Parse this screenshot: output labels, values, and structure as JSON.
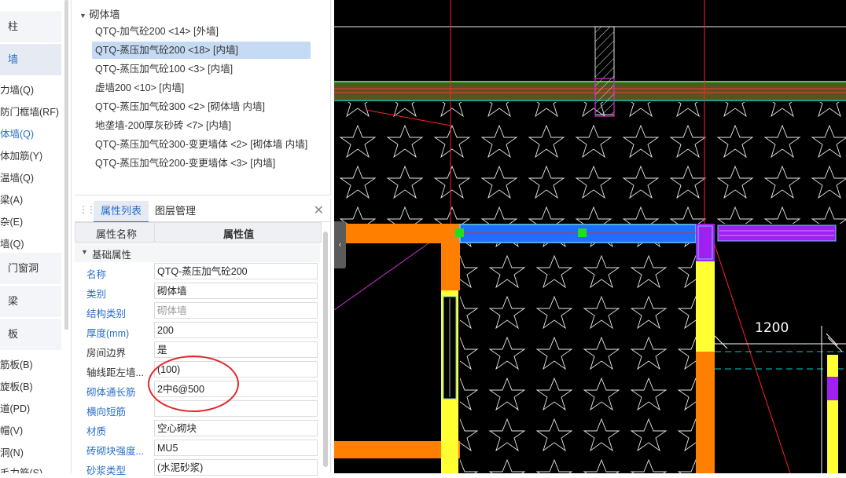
{
  "left_nav": {
    "items": [
      {
        "label": "柱",
        "type": "big"
      },
      {
        "label": "墙",
        "type": "big",
        "active": true
      },
      {
        "label": "力墙(Q)"
      },
      {
        "label": "防门框墙(RF)"
      },
      {
        "label": "体墙(Q)",
        "blue": true
      },
      {
        "label": "体加筋(Y)"
      },
      {
        "label": "温墙(Q)"
      },
      {
        "label": "梁(A)"
      },
      {
        "label": "杂(E)"
      },
      {
        "label": "墙(Q)"
      },
      {
        "label": "门窗洞",
        "type": "big"
      },
      {
        "label": "梁",
        "type": "big"
      },
      {
        "label": "板",
        "type": "big"
      },
      {
        "label": "筋板(B)"
      },
      {
        "label": "旋板(B)"
      },
      {
        "label": "道(PD)"
      },
      {
        "label": "帽(V)"
      },
      {
        "label": "洞(N)"
      },
      {
        "label": "毛力筋(S)"
      }
    ]
  },
  "tree": {
    "root": "砌体墙",
    "items": [
      {
        "label": "QTQ-加气砼200 <14> [外墙]"
      },
      {
        "label": "QTQ-蒸压加气砼200 <18> [内墙]",
        "selected": true
      },
      {
        "label": "QTQ-蒸压加气砼100 <3> [内墙]"
      },
      {
        "label": "虚墙200 <10> [内墙]"
      },
      {
        "label": "QTQ-蒸压加气砼300 <2> [砌体墙 内墙]"
      },
      {
        "label": "地垄墙-200厚灰砂砖 <7> [内墙]"
      },
      {
        "label": "QTQ-蒸压加气砼300-变更墙体 <2> [砌体墙 内墙]"
      },
      {
        "label": "QTQ-蒸压加气砼200-变更墙体 <3> [内墙]"
      }
    ]
  },
  "props": {
    "tabs": [
      "属性列表",
      "图层管理"
    ],
    "col_name": "属性名称",
    "col_value": "属性值",
    "group": "基础属性",
    "rows": [
      {
        "name": "名称",
        "value": "QTQ-蒸压加气砼200",
        "blue": true
      },
      {
        "name": "类别",
        "value": "砌体墙",
        "blue": true
      },
      {
        "name": "结构类别",
        "value": "砌体墙",
        "blue": true,
        "gray": true
      },
      {
        "name": "厚度(mm)",
        "value": "200",
        "blue": true
      },
      {
        "name": "房间边界",
        "value": "是"
      },
      {
        "name": "轴线距左墙...",
        "value": "(100)"
      },
      {
        "name": "砌体通长筋",
        "value": "2中6@500",
        "blue": true
      },
      {
        "name": "横向短筋",
        "value": "",
        "blue": true
      },
      {
        "name": "材质",
        "value": "空心砌块",
        "blue": true
      },
      {
        "name": "砖砌块强度...",
        "value": "MU5",
        "blue": true
      },
      {
        "name": "砂浆类型",
        "value": "(水泥砂浆)",
        "blue": true
      }
    ]
  },
  "cad": {
    "dimension_label": "1200"
  },
  "colors": {
    "accent_blue": "#2a6fc9",
    "selection": "#c5daf3",
    "annotation_red": "#e2262a",
    "wall_orange": "#ff7f00",
    "wall_yellow": "#ffff33",
    "selected_wall": "#1f6fff",
    "rebar_purple": "#a020f0"
  }
}
